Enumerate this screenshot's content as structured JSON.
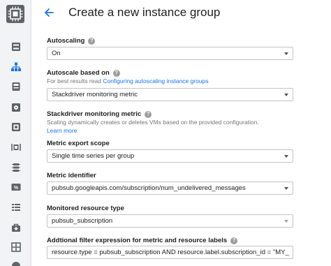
{
  "header": {
    "title": "Create a new instance group"
  },
  "nav": {
    "icons": [
      "compute-engine-chip-icon",
      "vm-instances-icon",
      "instance-groups-icon",
      "instance-templates-icon",
      "disks-icon",
      "snapshots-icon",
      "images-icon",
      "tpus-icon",
      "committed-use-icon",
      "metadata-icon",
      "health-checks-icon",
      "zones-icon",
      "network-endpoint-groups-icon"
    ]
  },
  "form": {
    "autoscaling": {
      "label": "Autoscaling",
      "value": "On"
    },
    "autoscale_based_on": {
      "label": "Autoscale based on",
      "hint_prefix": "For best results read",
      "hint_link": "Configuring autoscaling instance groups",
      "value": "Stackdriver monitoring metric"
    },
    "stackdriver_metric": {
      "label": "Stackdriver monitoring metric",
      "description": "Scaling dynamically creates or deletes VMs based on the provided configuration.",
      "learn_more": "Learn more"
    },
    "metric_export_scope": {
      "label": "Metric export scope",
      "value": "Single time series per group"
    },
    "metric_identifier": {
      "label": "Metric identifier",
      "value": "pubsub.googleapis.com/subscription/num_undelivered_messages"
    },
    "monitored_resource_type": {
      "label": "Monitored resource type",
      "value": "pubsub_subscription"
    },
    "filter_expression": {
      "label": "Addtional filter expression for metric and resource labels",
      "value": "resource.type = pubsub_subscription AND resource.label.subscription_id = \"MY_"
    }
  },
  "colors": {
    "accent": "#1a73e8",
    "rail_background": "#f1f3f4",
    "icon_grey": "#5f6368"
  }
}
